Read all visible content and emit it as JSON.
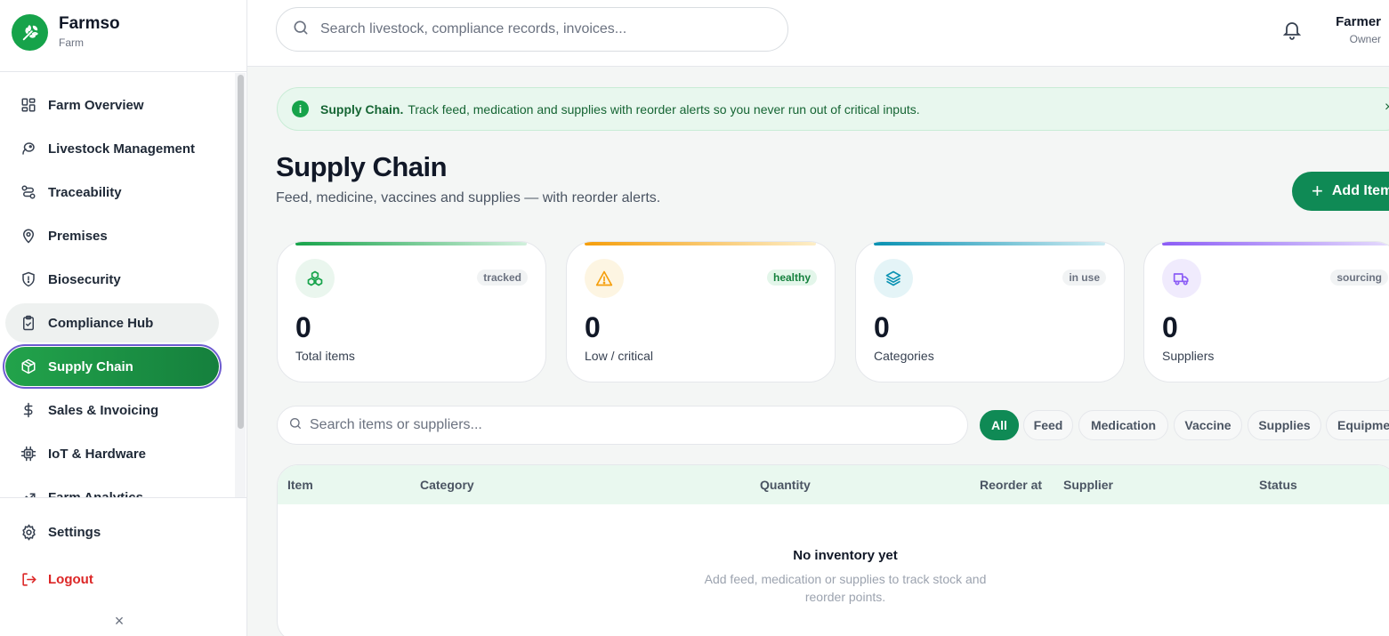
{
  "brand": {
    "name": "Farmso",
    "subtitle": "Farm"
  },
  "sidebar": {
    "items": [
      {
        "label": "Farm Overview",
        "icon": "grid-icon"
      },
      {
        "label": "Livestock Management",
        "icon": "livestock-icon"
      },
      {
        "label": "Traceability",
        "icon": "route-icon"
      },
      {
        "label": "Premises",
        "icon": "map-pin-icon"
      },
      {
        "label": "Biosecurity",
        "icon": "shield-alert-icon"
      },
      {
        "label": "Compliance Hub",
        "icon": "clipboard-check-icon"
      },
      {
        "label": "Supply Chain",
        "icon": "package-icon",
        "active": true
      },
      {
        "label": "Sales & Invoicing",
        "icon": "dollar-icon"
      },
      {
        "label": "IoT & Hardware",
        "icon": "chip-icon"
      },
      {
        "label": "Farm Analytics",
        "icon": "trend-icon"
      }
    ],
    "settings_label": "Settings",
    "logout_label": "Logout"
  },
  "topbar": {
    "search_placeholder": "Search livestock, compliance records, invoices...",
    "user_name": "Farmer",
    "user_role": "Owner"
  },
  "banner": {
    "title": "Supply Chain.",
    "text": "Track feed, medication and supplies with reorder alerts so you never run out of critical inputs."
  },
  "page": {
    "title": "Supply Chain",
    "subtitle": "Feed, medicine, vaccines and supplies — with reorder alerts.",
    "add_button": "Add Item"
  },
  "stats": [
    {
      "value": "0",
      "label": "Total items",
      "badge": "tracked",
      "icon": "boxes-icon",
      "color": "#16a34a"
    },
    {
      "value": "0",
      "label": "Low / critical",
      "badge": "healthy",
      "icon": "warning-icon",
      "color": "#f59e0b"
    },
    {
      "value": "0",
      "label": "Categories",
      "badge": "in use",
      "icon": "layers-icon",
      "color": "#0891b2"
    },
    {
      "value": "0",
      "label": "Suppliers",
      "badge": "sourcing",
      "icon": "truck-icon",
      "color": "#8b5cf6"
    }
  ],
  "filters": {
    "search_placeholder": "Search items or suppliers...",
    "chips": [
      "All",
      "Feed",
      "Medication",
      "Vaccine",
      "Supplies",
      "Equipment"
    ]
  },
  "table": {
    "columns": [
      "Item",
      "Category",
      "Quantity",
      "Reorder at",
      "Supplier",
      "Status"
    ],
    "empty_title": "No inventory yet",
    "empty_text": "Add feed, medication or supplies to track stock and reorder points."
  }
}
